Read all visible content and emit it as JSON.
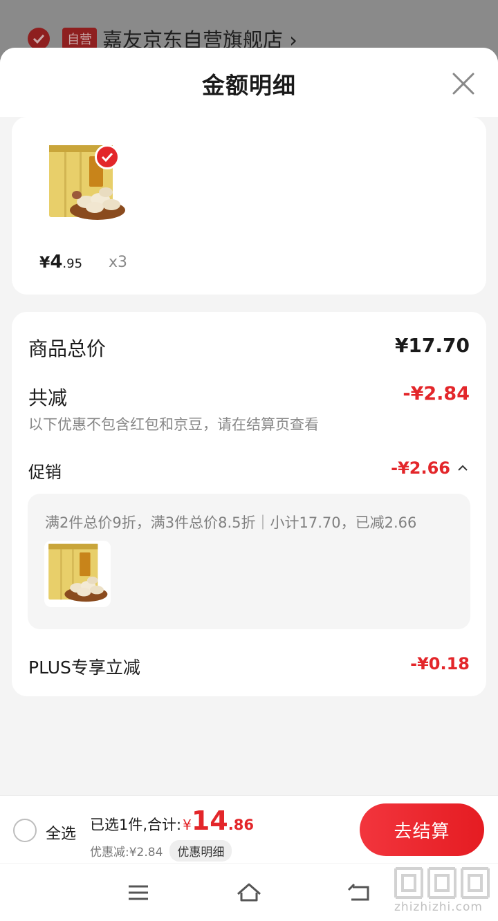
{
  "background": {
    "shop_badge": "自营",
    "shop_name": "嘉友京东自营旗舰店",
    "shop_chevron": "›"
  },
  "sheet": {
    "title": "金额明细"
  },
  "product": {
    "price_symbol": "¥",
    "price_int": "4",
    "price_dec": ".95",
    "quantity": "x3",
    "selected": true
  },
  "details": {
    "total_label": "商品总价",
    "total_value": "¥17.70",
    "reduce_label": "共减",
    "reduce_value": "-¥2.84",
    "reduce_note": "以下优惠不包含红包和京豆，请在结算页查看",
    "promo_label": "促销",
    "promo_value": "-¥2.66",
    "promo_chevron": "︿",
    "promo_desc": "满2件总价9折，满3件总价8.5折｜小计17.70，已减2.66",
    "plus_label": "PLUS专享立减",
    "plus_value": "-¥0.18"
  },
  "bottom": {
    "select_all": "全选",
    "summary_text": "已选1件,合计:",
    "sum_symbol": "¥",
    "sum_int": "14",
    "sum_dec": ".86",
    "discount_text": "优惠减:¥2.84",
    "discount_link": "优惠明细",
    "checkout": "去结算"
  },
  "watermark": {
    "text": "zhizhizhi.com"
  },
  "colors": {
    "accent_red": "#e3262a",
    "sheet_bg": "#f4f4f4"
  }
}
